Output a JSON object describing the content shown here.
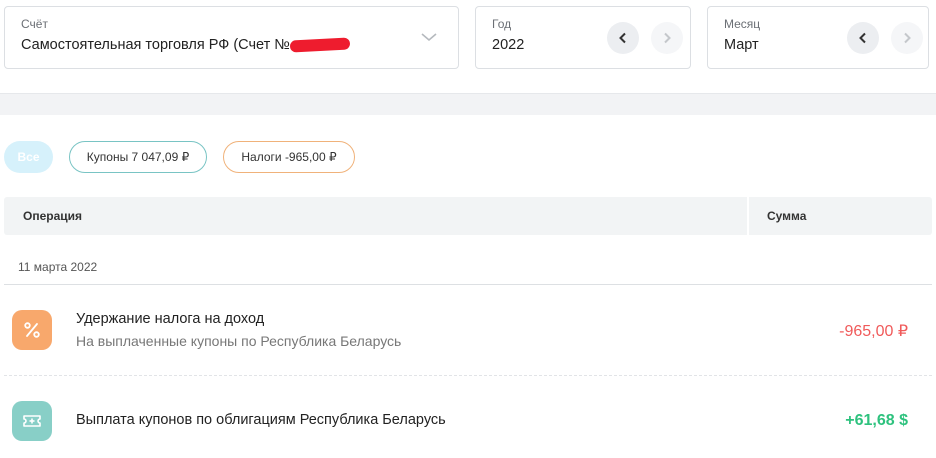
{
  "filters": {
    "account": {
      "label": "Счёт",
      "value": "Самостоятельная торговля РФ (Счет №"
    },
    "year": {
      "label": "Год",
      "value": "2022"
    },
    "month": {
      "label": "Месяц",
      "value": "Март"
    }
  },
  "pills": {
    "all": "Все",
    "coupons": "Купоны 7 047,09 ₽",
    "taxes": "Налоги -965,00 ₽"
  },
  "table": {
    "columns": {
      "operation": "Операция",
      "sum": "Сумма"
    },
    "date": "11 марта 2022",
    "rows": [
      {
        "icon": "percent-icon",
        "title": "Удержание налога на доход",
        "subtitle": "На выплаченные купоны по Республика Беларусь",
        "amount": "-965,00 ₽",
        "color": "#f05a5a"
      },
      {
        "icon": "coupon-ticket-icon",
        "title": "Выплата купонов по облигациям Республика Беларусь",
        "amount": "+61,68 $",
        "color": "#2ec27e"
      }
    ]
  },
  "colors": {
    "tax_icon_bg": "#f8a86c",
    "coupon_icon_bg": "#88cfc7",
    "redaction": "#ee1c2e"
  }
}
